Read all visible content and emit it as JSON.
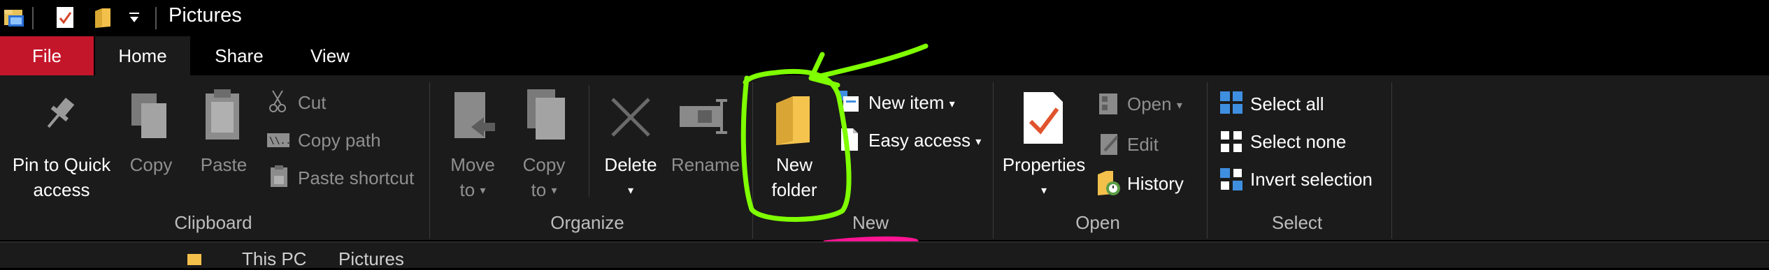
{
  "window": {
    "title": "Pictures"
  },
  "tabs": [
    {
      "label": "File"
    },
    {
      "label": "Home"
    },
    {
      "label": "Share"
    },
    {
      "label": "View"
    }
  ],
  "clipboard": {
    "pin_line1": "Pin to Quick",
    "pin_line2": "access",
    "copy": "Copy",
    "paste": "Paste",
    "cut": "Cut",
    "copy_path": "Copy path",
    "paste_shortcut": "Paste shortcut",
    "group_label": "Clipboard"
  },
  "organize": {
    "move_to_line1": "Move",
    "move_to_line2": "to",
    "copy_to_line1": "Copy",
    "copy_to_line2": "to",
    "delete": "Delete",
    "rename": "Rename",
    "group_label": "Organize"
  },
  "new": {
    "new_folder_line1": "New",
    "new_folder_line2": "folder",
    "new_item": "New item",
    "easy_access": "Easy access",
    "group_label": "New"
  },
  "open": {
    "properties": "Properties",
    "open": "Open",
    "edit": "Edit",
    "history": "History",
    "group_label": "Open"
  },
  "select": {
    "select_all": "Select all",
    "select_none": "Select none",
    "invert_selection": "Invert selection",
    "group_label": "Select"
  },
  "pathbar": {
    "crumb1": "This PC",
    "crumb2": "Pictures"
  },
  "annotations": {
    "highlight_color": "#7fff00",
    "underline_color": "#ff1493"
  }
}
